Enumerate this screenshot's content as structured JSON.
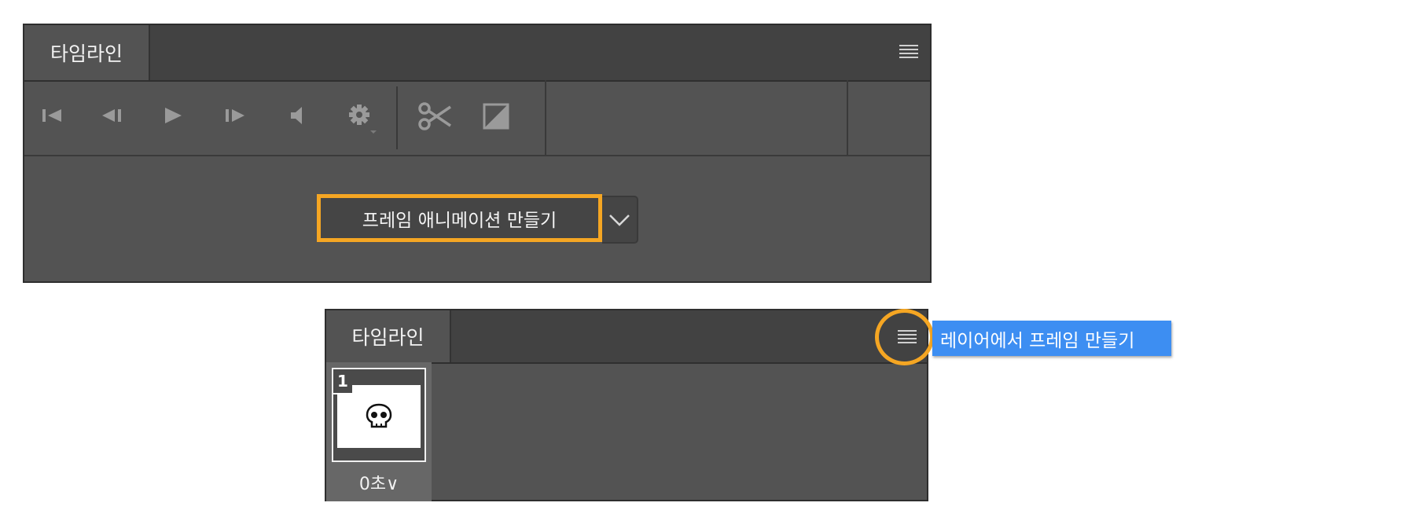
{
  "top_panel": {
    "tab_label": "타임라인",
    "panel_menu_icon": "panel-menu-icon",
    "toolbar": [
      {
        "name": "go-to-first-frame",
        "icon": "skip-to-start-icon"
      },
      {
        "name": "previous-frame",
        "icon": "step-back-icon"
      },
      {
        "name": "play",
        "icon": "play-icon"
      },
      {
        "name": "next-frame",
        "icon": "step-forward-icon"
      },
      {
        "name": "audio",
        "icon": "speaker-icon"
      },
      {
        "name": "settings",
        "icon": "gear-icon"
      },
      {
        "name": "split",
        "icon": "scissors-icon"
      },
      {
        "name": "transition",
        "icon": "transition-icon"
      }
    ],
    "create_select": {
      "value": "프레임 애니메이션 만들기",
      "icon": "chevron-down-icon"
    }
  },
  "bottom_panel": {
    "tab_label": "타임라인",
    "panel_menu_icon": "panel-menu-icon",
    "frame": {
      "number": "1",
      "delay": "0초∨",
      "thumbnail_icon": "skull-icon"
    },
    "tooltip": "레이어에서 프레임 만들기"
  },
  "colors": {
    "highlight": "#f5a623",
    "tooltip_bg": "#3d8ef2",
    "panel_bg": "#535353",
    "tabbar_bg": "#424242"
  }
}
